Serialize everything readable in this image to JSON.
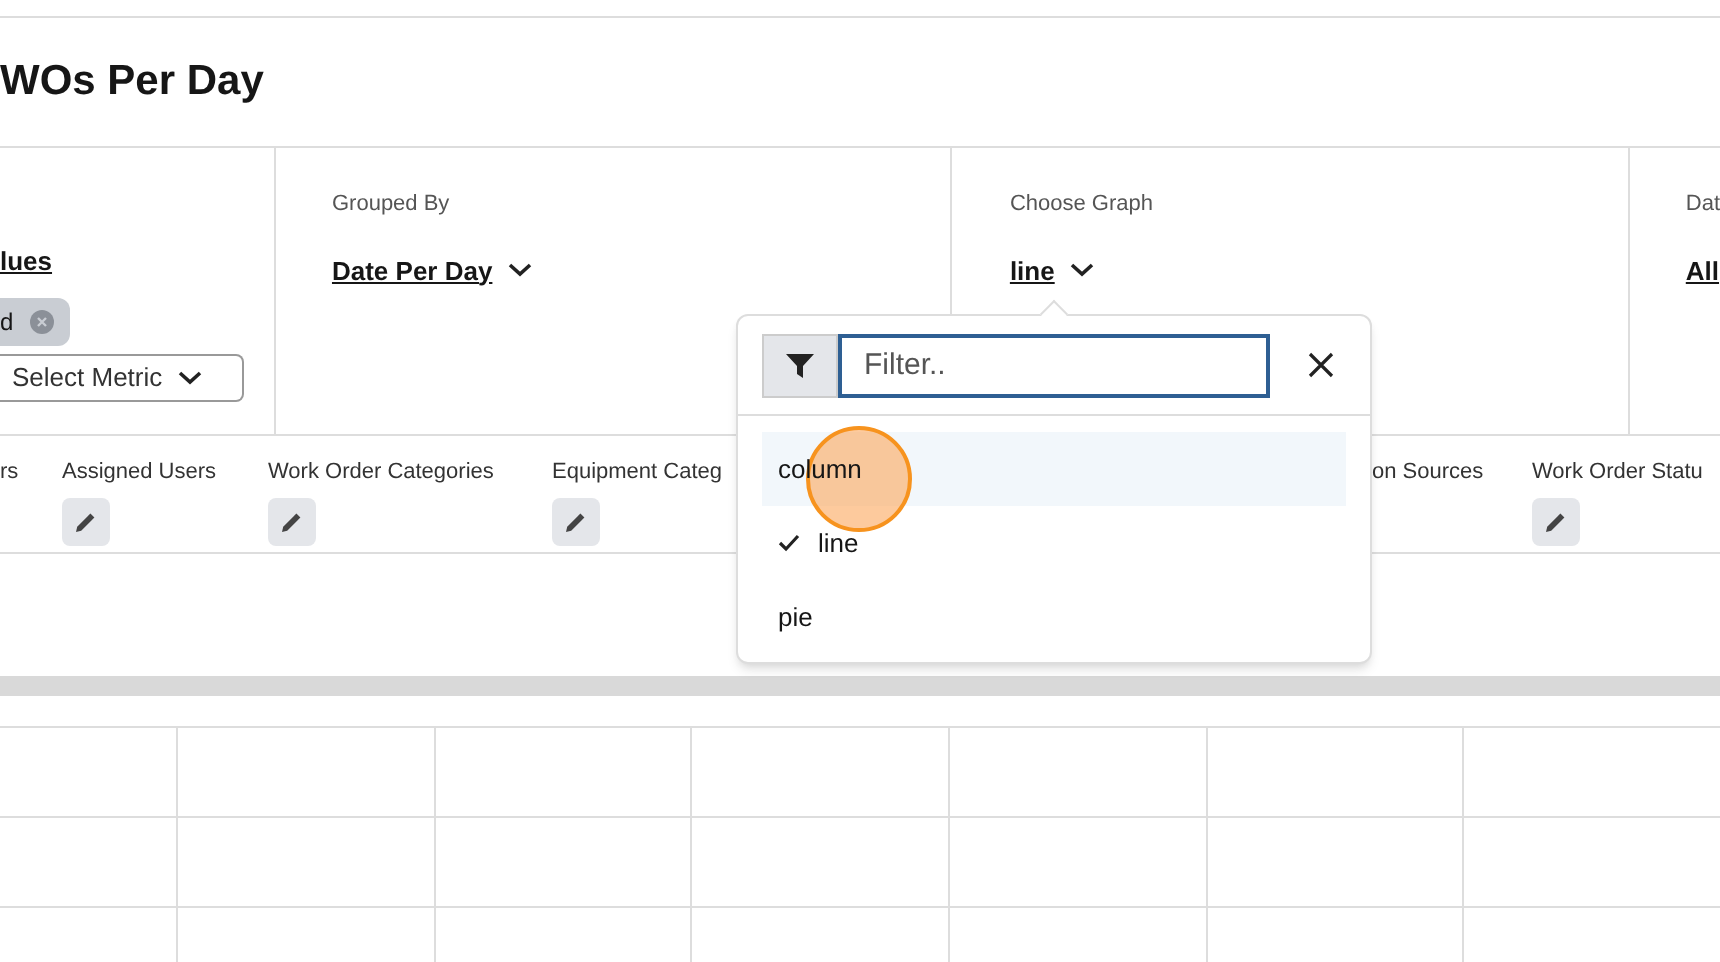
{
  "title": "WOs Per Day",
  "metrics": {
    "link": "lues",
    "tags": [
      {
        "label": "d"
      }
    ],
    "select": "Select Metric"
  },
  "grouped_by": {
    "label": "Grouped By",
    "value": "Date Per Day"
  },
  "choose_graph": {
    "label": "Choose Graph",
    "value": "line"
  },
  "date": {
    "label": "Dat",
    "value": "All"
  },
  "filters": [
    {
      "label": "rs",
      "pencil": false
    },
    {
      "label": "Assigned Users",
      "pencil": true
    },
    {
      "label": "Work Order Categories",
      "pencil": true
    },
    {
      "label": "Equipment Categ",
      "pencil": true
    },
    {
      "label": "on Sources",
      "pencil": false
    },
    {
      "label": "Work Order Statu",
      "pencil": true
    }
  ],
  "graph_menu": {
    "placeholder": "Filter..",
    "options": [
      {
        "label": "column",
        "selected": false,
        "highlighted": true
      },
      {
        "label": "line",
        "selected": true,
        "highlighted": false
      },
      {
        "label": "pie",
        "selected": false,
        "highlighted": false
      }
    ]
  }
}
